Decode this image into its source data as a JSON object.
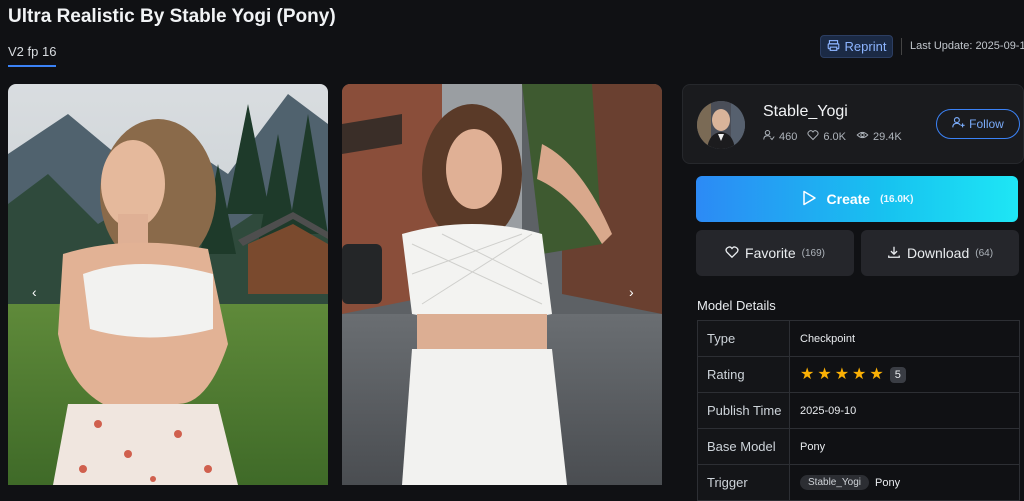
{
  "model": {
    "title": "Ultra Realistic By Stable Yogi (Pony)",
    "version_tab": "V2 fp 16"
  },
  "header": {
    "reprint_label": "Reprint",
    "last_update_label": "Last Update:",
    "last_update_value": "2025-09-1"
  },
  "gallery": {
    "prev_label": "‹",
    "next_label": "›",
    "images": [
      {
        "alt": "woman in white lace top on mountain meadow"
      },
      {
        "alt": "woman in white mesh top on city street"
      }
    ]
  },
  "creator": {
    "name": "Stable_Yogi",
    "followers": "460",
    "likes": "6.0K",
    "views": "29.4K",
    "follow_label": "Follow"
  },
  "actions": {
    "create_label": "Create",
    "create_count": "(16.0K)",
    "favorite_label": "Favorite",
    "favorite_count": "(169)",
    "download_label": "Download",
    "download_count": "(64)"
  },
  "details": {
    "title": "Model Details",
    "type_label": "Type",
    "type_value": "Checkpoint",
    "rating_label": "Rating",
    "rating_value": "5",
    "publish_label": "Publish Time",
    "publish_value": "2025-09-10",
    "base_label": "Base Model",
    "base_value": "Pony",
    "trigger_label": "Trigger",
    "trigger_tag": "Stable_Yogi",
    "trigger_extra": "Pony"
  },
  "colors": {
    "accent": "#3b82f6",
    "star": "#fab005",
    "background": "#101114"
  }
}
